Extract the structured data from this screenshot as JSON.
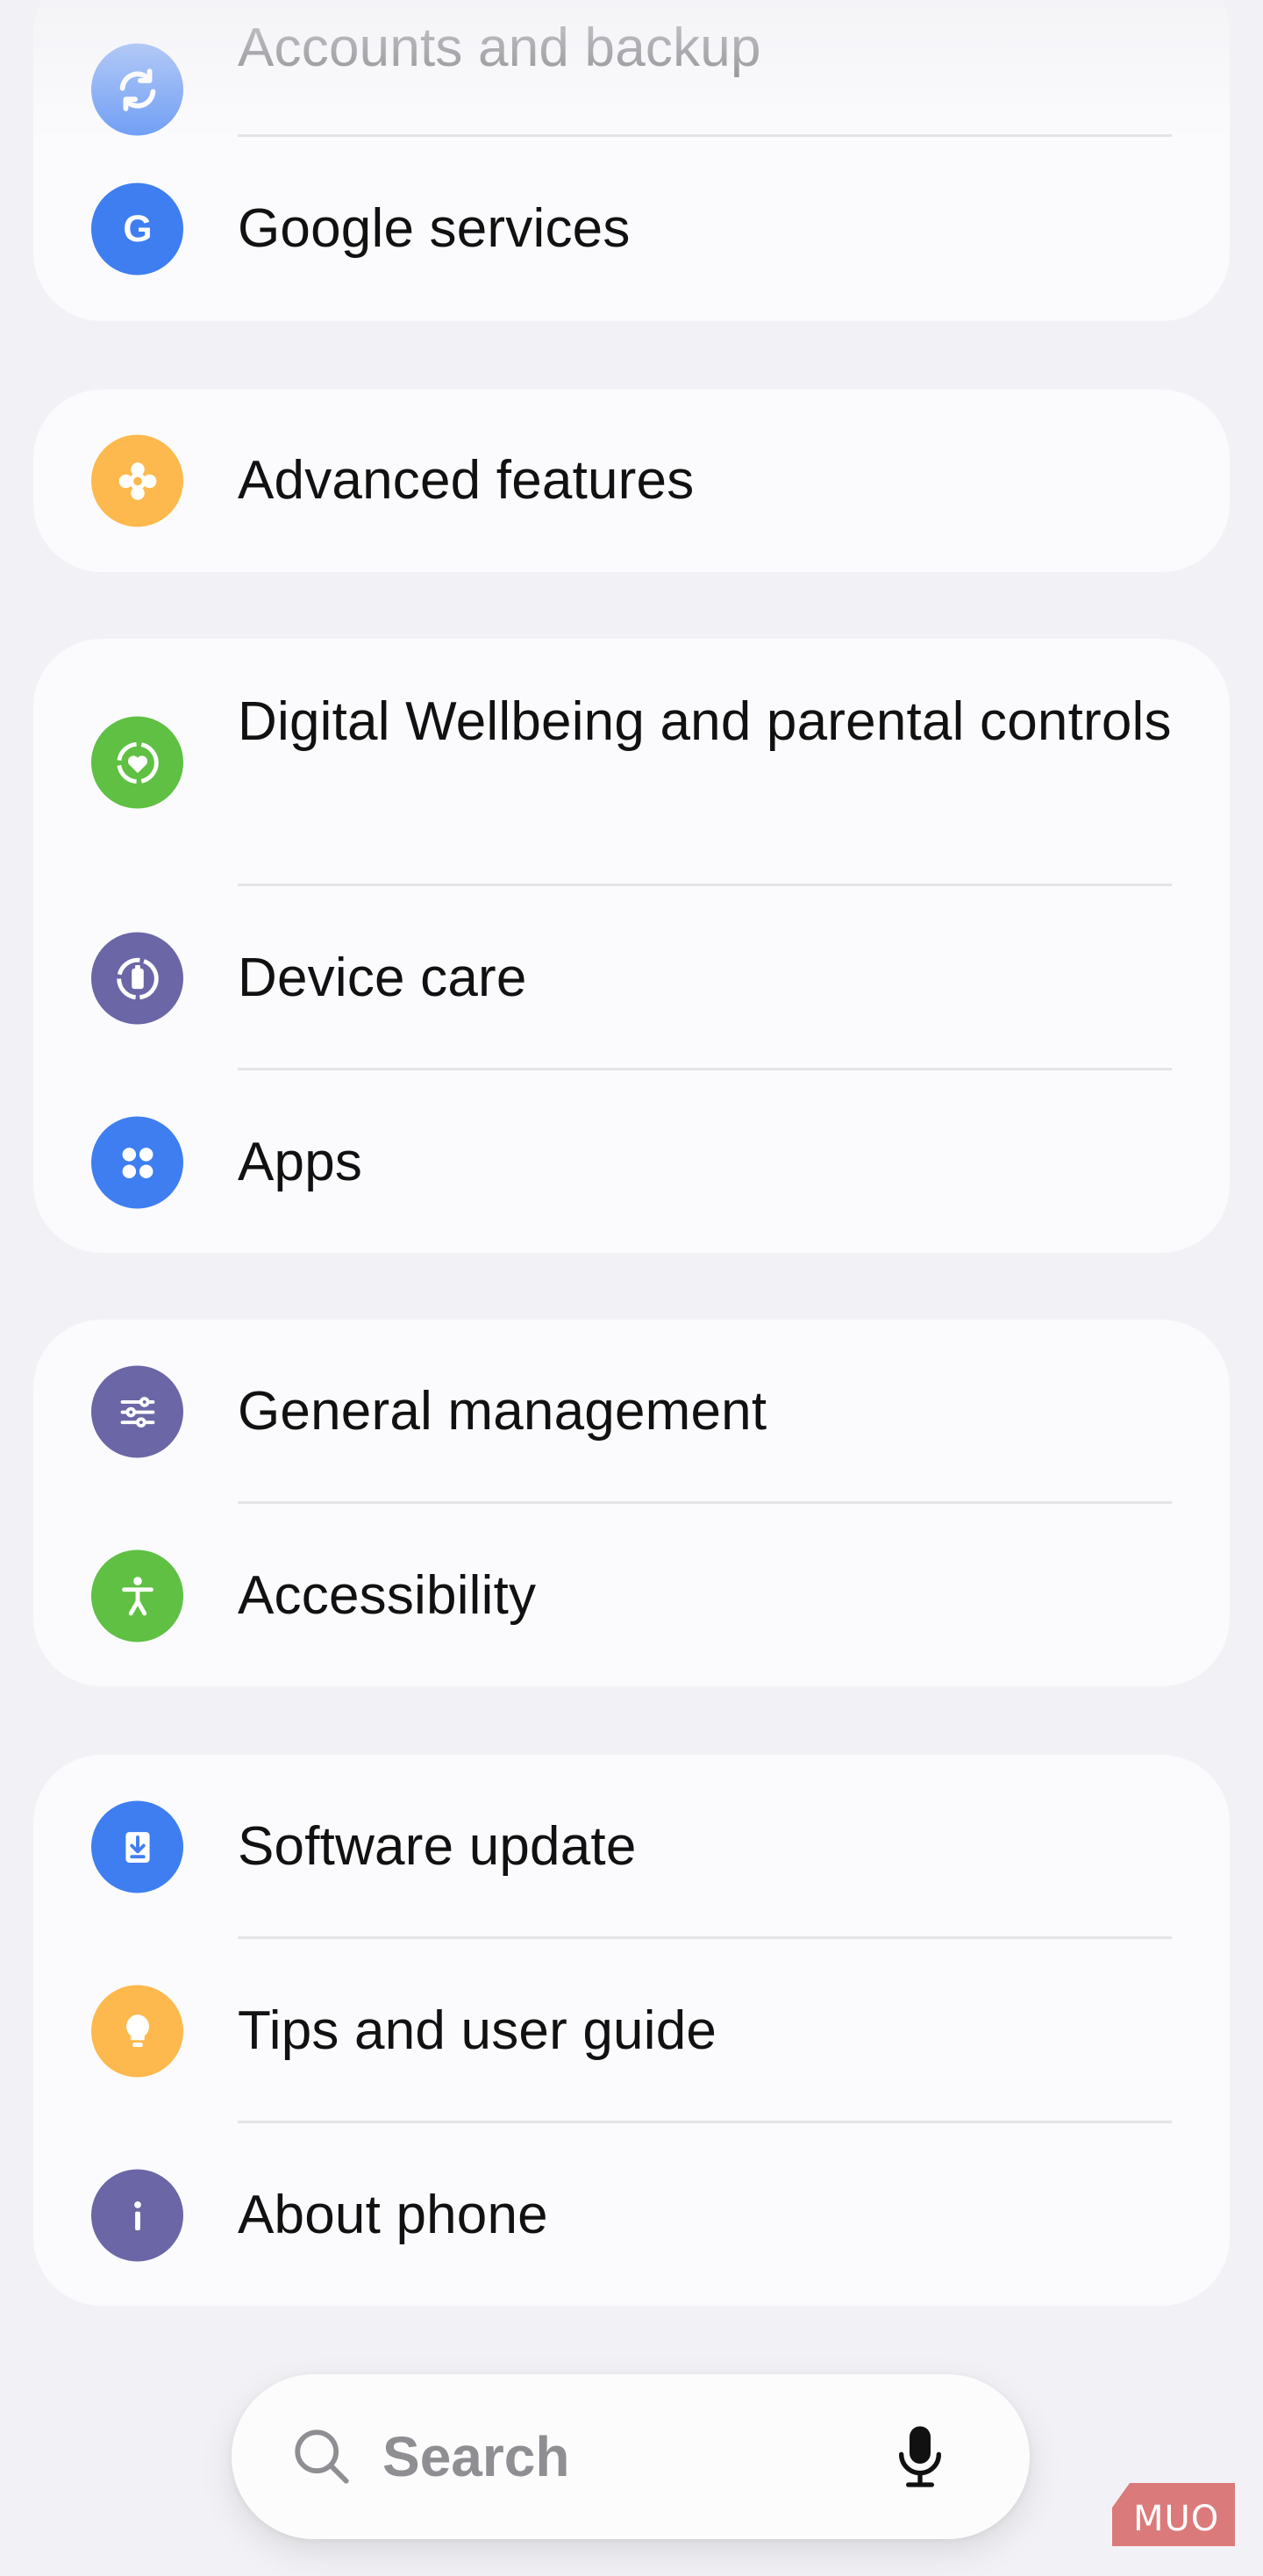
{
  "colors": {
    "background": "#f2f2f6",
    "card": "#fbfbfd",
    "blue": "#3f7ef0",
    "light_blue": "#6e9df5",
    "orange": "#fdb94d",
    "green": "#5fc043",
    "purple": "#6b66a6",
    "watermark": "#d86d6d"
  },
  "groups": [
    {
      "items": [
        {
          "label": "Accounts and backup",
          "icon": "sync-icon"
        },
        {
          "label": "Google services",
          "icon": "google-icon"
        }
      ]
    },
    {
      "items": [
        {
          "label": "Advanced features",
          "icon": "puzzle-gear-icon"
        }
      ]
    },
    {
      "items": [
        {
          "label": "Digital Wellbeing and parental controls",
          "icon": "heart-ring-icon"
        },
        {
          "label": "Device care",
          "icon": "battery-ring-icon"
        },
        {
          "label": "Apps",
          "icon": "apps-grid-icon"
        }
      ]
    },
    {
      "items": [
        {
          "label": "General management",
          "icon": "sliders-icon"
        },
        {
          "label": "Accessibility",
          "icon": "accessibility-icon"
        }
      ]
    },
    {
      "items": [
        {
          "label": "Software update",
          "icon": "download-icon"
        },
        {
          "label": "Tips and user guide",
          "icon": "lightbulb-icon"
        },
        {
          "label": "About phone",
          "icon": "info-icon"
        }
      ]
    }
  ],
  "search": {
    "placeholder": "Search"
  },
  "watermark": {
    "text": "MUO"
  }
}
